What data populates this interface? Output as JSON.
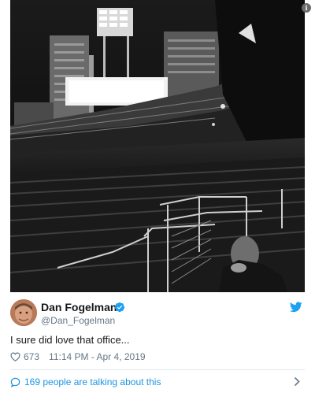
{
  "tweet": {
    "display_name": "Dan Fogelman",
    "handle": "@Dan_Fogelman",
    "text": "I sure did love that office...",
    "likes": "673",
    "timestamp": "11:14 PM - Apr 4, 2019",
    "talking_about": "169 people are talking about this",
    "verified": true
  },
  "media": {
    "info_badge": "i",
    "description_icon": "stadium-photo"
  },
  "icons": {
    "verified": "verified-badge-icon",
    "brand": "twitter-bird-icon",
    "like": "heart-icon",
    "conversation": "speech-bubble-icon",
    "more": "chevron-right-icon"
  },
  "colors": {
    "accent": "#1da1f2",
    "link": "#1b95e0",
    "muted": "#657786",
    "text": "#14171a",
    "divider": "#e1e8ed"
  }
}
